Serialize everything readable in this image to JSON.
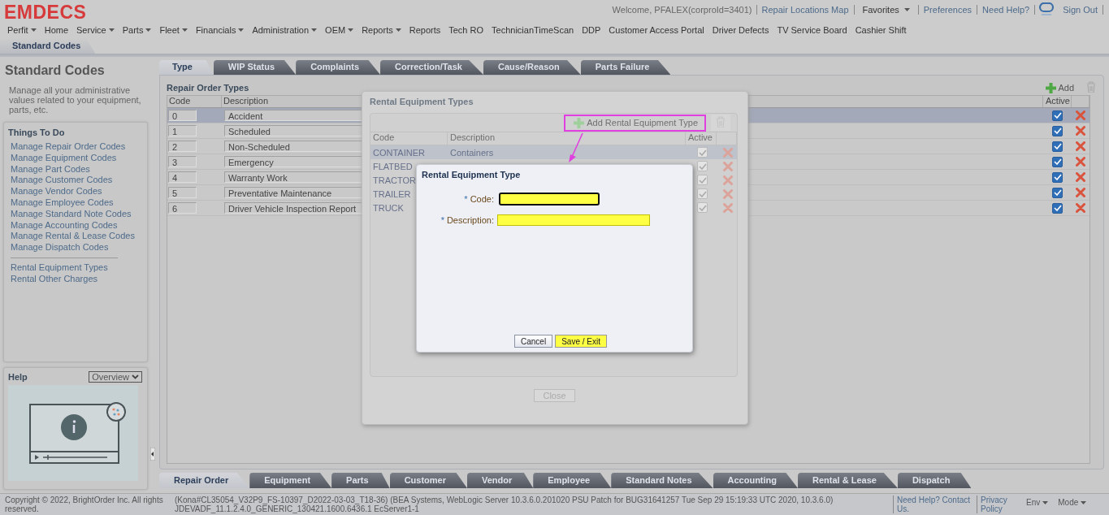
{
  "header": {
    "logo": "EMDECS",
    "welcome": "Welcome, PFALEX(corproId=3401)",
    "links": [
      {
        "kind": "link",
        "label": "Repair Locations Map"
      },
      {
        "kind": "dropdown",
        "label": "Favorites"
      },
      {
        "kind": "link",
        "label": "Preferences"
      },
      {
        "kind": "link",
        "label": "Need Help?"
      },
      {
        "kind": "icon"
      },
      {
        "kind": "link",
        "label": "Sign Out"
      }
    ]
  },
  "menu": [
    {
      "label": "Perfit",
      "dropdown": true
    },
    {
      "label": "Home",
      "dropdown": false
    },
    {
      "label": "Service",
      "dropdown": true
    },
    {
      "label": "Parts",
      "dropdown": true
    },
    {
      "label": "Fleet",
      "dropdown": true
    },
    {
      "label": "Financials",
      "dropdown": true
    },
    {
      "label": "Administration",
      "dropdown": true
    },
    {
      "label": "OEM",
      "dropdown": true
    },
    {
      "label": "Reports",
      "dropdown": true
    },
    {
      "label": "Reports",
      "dropdown": false
    },
    {
      "label": "Tech RO",
      "dropdown": false
    },
    {
      "label": "TechnicianTimeScan",
      "dropdown": false
    },
    {
      "label": "DDP",
      "dropdown": false
    },
    {
      "label": "Customer Access Portal",
      "dropdown": false
    },
    {
      "label": "Driver Defects",
      "dropdown": false
    },
    {
      "label": "TV Service Board",
      "dropdown": false
    },
    {
      "label": "Cashier Shift",
      "dropdown": false
    }
  ],
  "page_tab": "Standard Codes",
  "sidebar": {
    "title": "Standard Codes",
    "description": "Manage all your administrative values related to your equipment, parts, etc.",
    "todo": {
      "title": "Things To Do",
      "groups": [
        [
          "Manage Repair Order Codes",
          "Manage Equipment Codes",
          "Manage Part Codes",
          "Manage Customer Codes",
          "Manage Vendor Codes",
          "Manage Employee Codes",
          "Manage Standard Note Codes",
          "Manage Accounting Codes",
          "Manage Rental & Lease Codes",
          "Manage Dispatch Codes"
        ],
        [
          "Rental Equipment Types",
          "Rental Other Charges"
        ]
      ]
    },
    "help": {
      "title": "Help",
      "dropdown": "Overview"
    }
  },
  "tabs": [
    {
      "label": "Type",
      "selected": true
    },
    {
      "label": "WIP Status",
      "selected": false
    },
    {
      "label": "Complaints",
      "selected": false
    },
    {
      "label": "Correction/Task",
      "selected": false
    },
    {
      "label": "Cause/Reason",
      "selected": false
    },
    {
      "label": "Parts Failure",
      "selected": false
    }
  ],
  "panel": {
    "title": "Repair Order Types",
    "add_label": "Add",
    "columns": [
      "Code",
      "Description",
      "Active"
    ],
    "rows": [
      {
        "code": "0",
        "description": "Accident",
        "active": true,
        "selected": true
      },
      {
        "code": "1",
        "description": "Scheduled",
        "active": true,
        "selected": false
      },
      {
        "code": "2",
        "description": "Non-Scheduled",
        "active": true,
        "selected": false
      },
      {
        "code": "3",
        "description": "Emergency",
        "active": true,
        "selected": false
      },
      {
        "code": "4",
        "description": "Warranty Work",
        "active": true,
        "selected": false
      },
      {
        "code": "5",
        "description": "Preventative Maintenance",
        "active": true,
        "selected": false
      },
      {
        "code": "6",
        "description": "Driver Vehicle Inspection Report",
        "active": true,
        "selected": false
      }
    ]
  },
  "bottom_tabs": [
    {
      "label": "Repair Order",
      "selected": true
    },
    {
      "label": "Equipment",
      "selected": false
    },
    {
      "label": "Parts",
      "selected": false
    },
    {
      "label": "Customer",
      "selected": false
    },
    {
      "label": "Vendor",
      "selected": false
    },
    {
      "label": "Employee",
      "selected": false
    },
    {
      "label": "Standard Notes",
      "selected": false
    },
    {
      "label": "Accounting",
      "selected": false
    },
    {
      "label": "Rental & Lease",
      "selected": false
    },
    {
      "label": "Dispatch",
      "selected": false
    }
  ],
  "footer": {
    "copyright": "Copyright © 2022, BrightOrder Inc. All rights reserved.",
    "version": "(Kona#CL35054_V32P9_FS-10397_D2022-03-03_T18-36) (BEA Systems, WebLogic Server 10.3.6.0.201020 PSU Patch for BUG31641257 Tue Sep 29 15:19:33 UTC 2020, 10.3.6.0) JDEVADF_11.1.2.4.0_GENERIC_130421.1600.6436.1 EcServer1-1",
    "links": [
      "Need Help? Contact Us.",
      "Privacy Policy"
    ],
    "menus": [
      "Env",
      "Mode"
    ]
  },
  "rental_types": {
    "title": "Rental Equipment Types",
    "add": {
      "label": "Add Rental Equipment Type",
      "highlighted": true
    },
    "columns": [
      "Code",
      "Description",
      "Active"
    ],
    "rows": [
      {
        "code": "CONTAINER",
        "description": "Containers",
        "active": true,
        "selected": true
      },
      {
        "code": "FLATBED",
        "active": true,
        "selected": false
      },
      {
        "code": "TRACTOR",
        "active": true,
        "selected": false
      },
      {
        "code": "TRAILER",
        "active": true,
        "selected": false
      },
      {
        "code": "TRUCK",
        "active": true,
        "selected": false
      }
    ],
    "close": "Close"
  },
  "rental_type_dialog": {
    "title": "Rental Equipment Type",
    "fields": [
      {
        "marker": "*",
        "label": "Code:",
        "focused": true
      },
      {
        "marker": "*",
        "label": "Description:",
        "focused": false
      }
    ],
    "buttons": [
      {
        "label": "Cancel",
        "kind": "default"
      },
      {
        "label": "Save / Exit",
        "kind": "primary"
      }
    ]
  }
}
